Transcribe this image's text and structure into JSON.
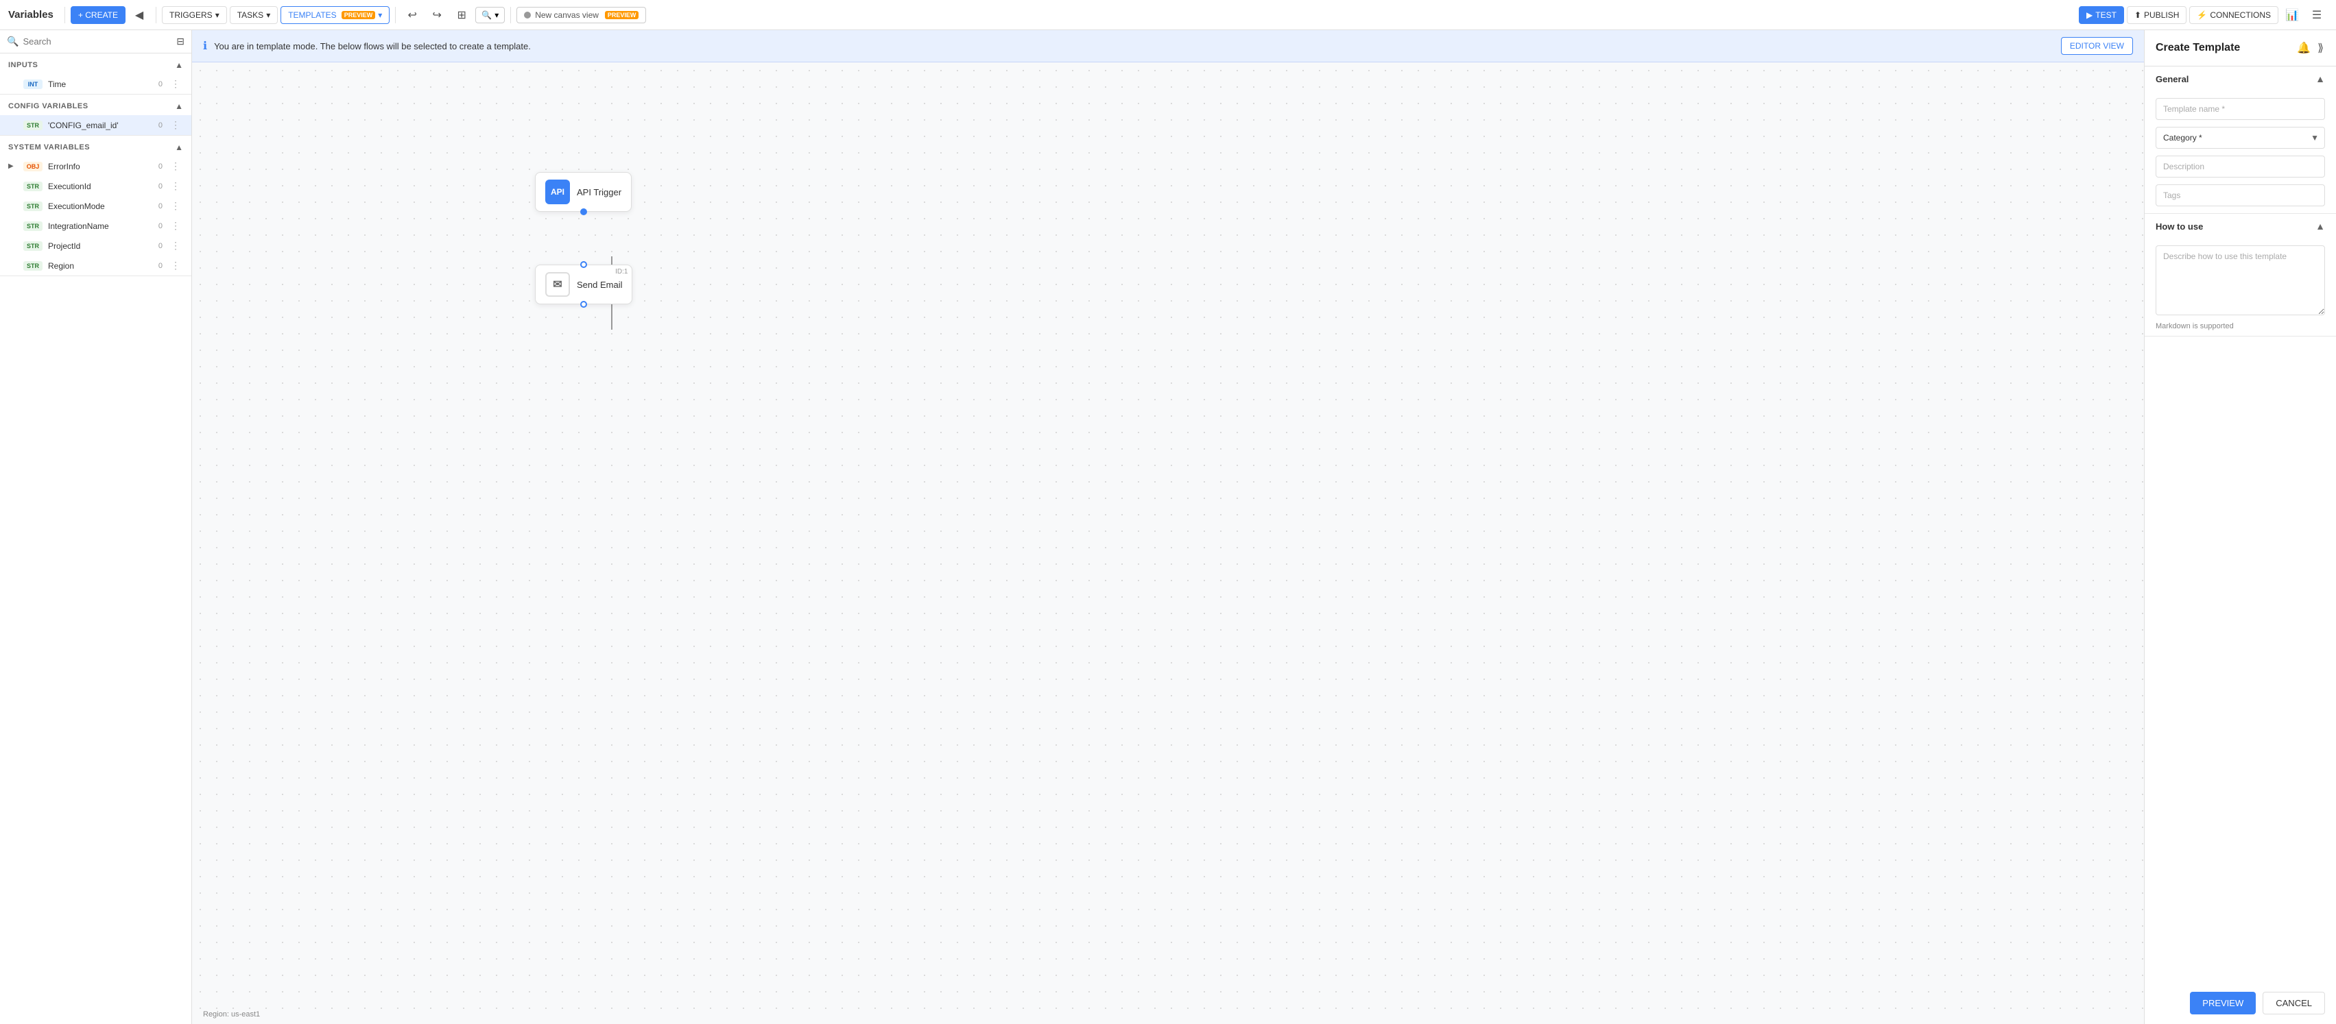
{
  "app": {
    "title": "Variables"
  },
  "topnav": {
    "create_label": "+ CREATE",
    "collapse_label": "◀",
    "triggers_label": "TRIGGERS",
    "tasks_label": "TASKS",
    "templates_label": "TEMPLATES",
    "preview_badge": "PREVIEW",
    "undo_label": "↩",
    "redo_label": "↪",
    "canvas_view_label": "New canvas view",
    "test_label": "TEST",
    "publish_label": "PUBLISH",
    "connections_label": "CONNECTIONS"
  },
  "sidebar": {
    "search_placeholder": "Search",
    "inputs_label": "Inputs",
    "config_label": "Config Variables",
    "system_label": "System Variables",
    "inputs_items": [
      {
        "type": "INT",
        "name": "Time",
        "count": "0"
      }
    ],
    "config_items": [
      {
        "type": "STR",
        "name": "'CONFIG_email_id'",
        "count": "0",
        "selected": true
      }
    ],
    "system_items": [
      {
        "type": "OBJ",
        "name": "ErrorInfo",
        "count": "0",
        "expandable": true
      },
      {
        "type": "STR",
        "name": "ExecutionId",
        "count": "0"
      },
      {
        "type": "STR",
        "name": "ExecutionMode",
        "count": "0"
      },
      {
        "type": "STR",
        "name": "IntegrationName",
        "count": "0"
      },
      {
        "type": "STR",
        "name": "ProjectId",
        "count": "0"
      },
      {
        "type": "STR",
        "name": "Region",
        "count": "0"
      }
    ]
  },
  "canvas": {
    "banner_text": "You are in template mode. The below flows will be selected to create a template.",
    "editor_view_label": "EDITOR VIEW",
    "api_node_label": "API Trigger",
    "email_node_label": "Send Email",
    "node_id_label": "ID:1",
    "region_label": "Region: us-east1"
  },
  "right_panel": {
    "title": "Create Template",
    "general_section": "General",
    "how_to_use_section": "How to use",
    "template_name_placeholder": "Template name *",
    "category_placeholder": "Category *",
    "description_placeholder": "Description",
    "tags_placeholder": "Tags",
    "how_to_use_placeholder": "Describe how to use this template",
    "markdown_note": "Markdown is supported",
    "preview_btn": "PREVIEW",
    "cancel_btn": "CANCEL"
  }
}
